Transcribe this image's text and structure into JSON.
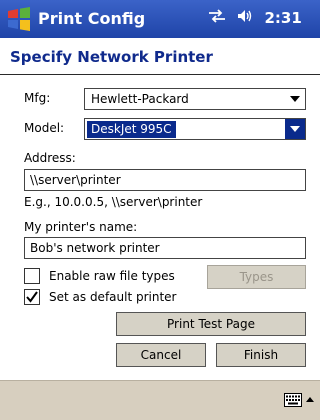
{
  "titlebar": {
    "app_title": "Print Config",
    "time": "2:31",
    "start_logo_colors": [
      "#e03c31",
      "#5bb03c",
      "#3c6ad0",
      "#f4c01c"
    ]
  },
  "page": {
    "title": "Specify Network Printer"
  },
  "form": {
    "mfg_label": "Mfg:",
    "mfg_value": "Hewlett-Packard",
    "model_label": "Model:",
    "model_value": "DeskJet 995C",
    "address_label": "Address:",
    "address_value": "\\\\server\\printer",
    "address_hint": "E.g., 10.0.0.5, \\\\server\\printer",
    "name_label": "My printer's name:",
    "name_value": "Bob's network  printer",
    "raw_label": "Enable raw file types",
    "raw_checked": false,
    "default_label": "Set as default printer",
    "default_checked": true
  },
  "buttons": {
    "types": "Types",
    "print_test": "Print Test Page",
    "cancel": "Cancel",
    "finish": "Finish"
  },
  "icons": {
    "connectivity": "connectivity-icon",
    "volume": "volume-icon",
    "keyboard": "keyboard-icon"
  }
}
